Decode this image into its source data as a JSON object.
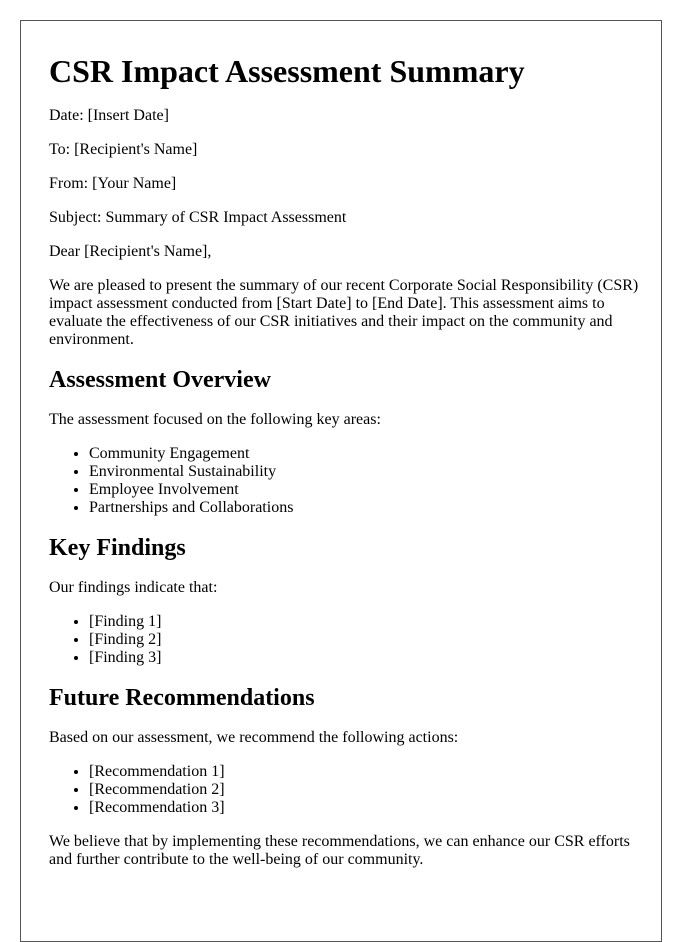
{
  "title": "CSR Impact Assessment Summary",
  "meta": {
    "date": "Date: [Insert Date]",
    "to": "To: [Recipient's Name]",
    "from": "From: [Your Name]",
    "subject": "Subject: Summary of CSR Impact Assessment"
  },
  "salutation": "Dear [Recipient's Name],",
  "intro": "We are pleased to present the summary of our recent Corporate Social Responsibility (CSR) impact assessment conducted from [Start Date] to [End Date]. This assessment aims to evaluate the effectiveness of our CSR initiatives and their impact on the community and environment.",
  "sections": [
    {
      "heading": "Assessment Overview",
      "lead": "The assessment focused on the following key areas:",
      "items": [
        "Community Engagement",
        "Environmental Sustainability",
        "Employee Involvement",
        "Partnerships and Collaborations"
      ]
    },
    {
      "heading": "Key Findings",
      "lead": "Our findings indicate that:",
      "items": [
        "[Finding 1]",
        "[Finding 2]",
        "[Finding 3]"
      ]
    },
    {
      "heading": "Future Recommendations",
      "lead": "Based on our assessment, we recommend the following actions:",
      "items": [
        "[Recommendation 1]",
        "[Recommendation 2]",
        "[Recommendation 3]"
      ]
    }
  ],
  "closing": "We believe that by implementing these recommendations, we can enhance our CSR efforts and further contribute to the well-being of our community."
}
